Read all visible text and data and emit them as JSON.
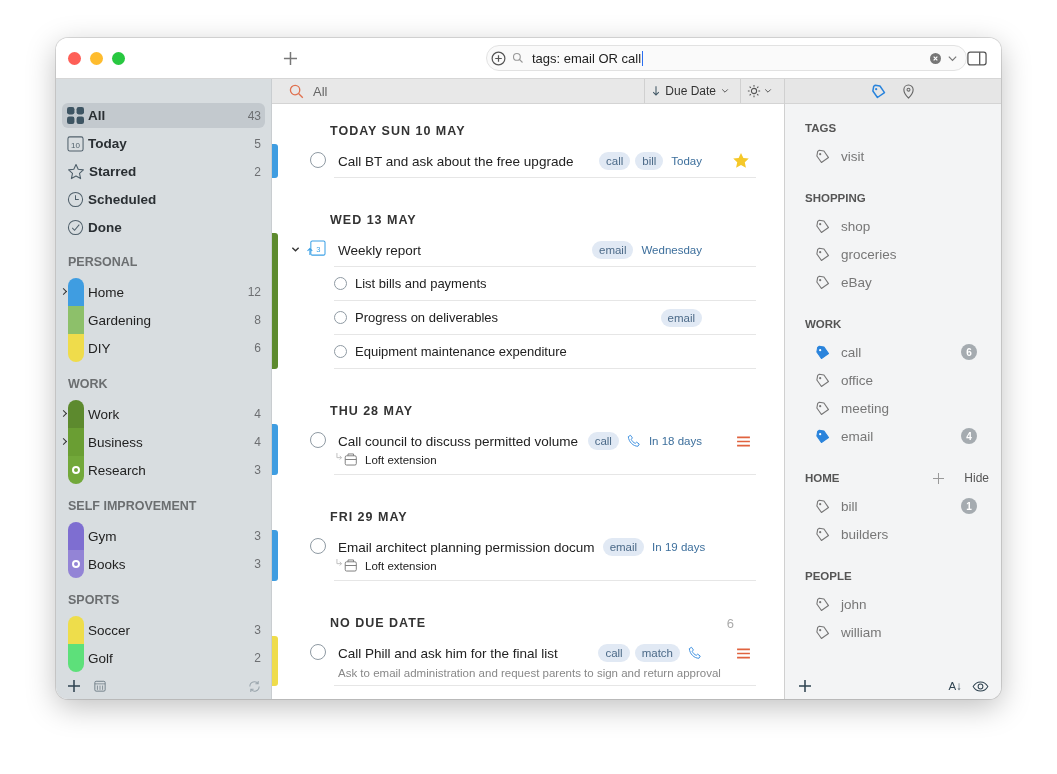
{
  "search": {
    "value": "tags: email OR call"
  },
  "filter_bar": {
    "label": "All",
    "sort": "Due Date"
  },
  "sidebar": {
    "smart": [
      {
        "kind": "all",
        "name": "All",
        "count": "43",
        "selected": true
      },
      {
        "kind": "today",
        "name": "Today",
        "count": "5",
        "day": "10",
        "selected": false
      },
      {
        "kind": "starred",
        "name": "Starred",
        "count": "2",
        "selected": false
      },
      {
        "kind": "scheduled",
        "name": "Scheduled",
        "selected": false
      },
      {
        "kind": "done",
        "name": "Done",
        "selected": false
      }
    ],
    "groups": [
      {
        "title": "PERSONAL",
        "lists": [
          {
            "name": "Home",
            "count": "12",
            "color": "#3f9de1",
            "has_children": true,
            "shared": false
          },
          {
            "name": "Gardening",
            "count": "8",
            "color": "#8dc06a",
            "has_children": false,
            "shared": false
          },
          {
            "name": "DIY",
            "count": "6",
            "color": "#efdc4b",
            "has_children": false,
            "shared": false
          }
        ]
      },
      {
        "title": "WORK",
        "lists": [
          {
            "name": "Work",
            "count": "4",
            "color": "#5d8a2e",
            "has_children": true,
            "shared": false
          },
          {
            "name": "Business",
            "count": "4",
            "color": "#6a9e33",
            "has_children": true,
            "shared": false
          },
          {
            "name": "Research",
            "count": "3",
            "color": "#72a83a",
            "has_children": false,
            "shared": true
          }
        ]
      },
      {
        "title": "SELF IMPROVEMENT",
        "lists": [
          {
            "name": "Gym",
            "count": "3",
            "color": "#7e6ed1",
            "has_children": false,
            "shared": false
          },
          {
            "name": "Books",
            "count": "3",
            "color": "#9384d6",
            "has_children": false,
            "shared": true
          }
        ]
      },
      {
        "title": "SPORTS",
        "lists": [
          {
            "name": "Soccer",
            "count": "3",
            "color": "#eedd4b",
            "has_children": false,
            "shared": false
          },
          {
            "name": "Golf",
            "count": "2",
            "color": "#5de07a",
            "has_children": false,
            "shared": false
          }
        ]
      }
    ]
  },
  "sections": [
    {
      "heading": "TODAY SUN 10 MAY",
      "tasks": [
        {
          "title": "Call BT and ask about the free upgrade",
          "checked": false,
          "color": "#3f9de1",
          "tags": [
            "call",
            "bill"
          ],
          "phone": false,
          "due": "Today",
          "starred": true,
          "priority": false
        }
      ]
    },
    {
      "heading": "WED 13 MAY",
      "tasks": [
        {
          "kind": "recurring",
          "checked": false,
          "title": "Weekly report",
          "repeat": "3",
          "expanded": true,
          "color": "#5d8a2e",
          "tags": [
            "email"
          ],
          "phone": false,
          "due": "Wednesday",
          "starred": false,
          "priority": false,
          "children": [
            {
              "title": "List bills and payments",
              "checked": false
            },
            {
              "title": "Progress on deliverables",
              "checked": false,
              "tags": [
                "email"
              ]
            },
            {
              "title": "Equipment maintenance expenditure",
              "checked": false
            }
          ]
        }
      ]
    },
    {
      "heading": "THU 28 MAY",
      "tasks": [
        {
          "title": "Call council to discuss permitted volume",
          "checked": false,
          "color": "#3f9de1",
          "tags": [
            "call"
          ],
          "phone": true,
          "due": "In 18 days",
          "starred": false,
          "priority": true,
          "project": "Loft extension"
        }
      ]
    },
    {
      "heading": "FRI 29 MAY",
      "tasks": [
        {
          "title": "Email architect planning permission docum",
          "checked": false,
          "color": "#3f9de1",
          "tags": [
            "email"
          ],
          "phone": false,
          "due": "In 19 days",
          "starred": false,
          "priority": false,
          "project": "Loft extension"
        }
      ]
    },
    {
      "heading": "NO DUE DATE",
      "count": "6",
      "tasks": [
        {
          "title": "Call Phill and ask him for the final list",
          "checked": false,
          "color": "#efdc4b",
          "tags": [
            "call",
            "match"
          ],
          "phone": true,
          "starred": false,
          "priority": true,
          "note": "Ask to email administration and request parents to sign and return approval"
        }
      ]
    }
  ],
  "tag_panel": {
    "tabs": [
      {
        "kind": "tags",
        "selected": true
      },
      {
        "kind": "places",
        "selected": false
      }
    ],
    "groups": [
      {
        "title": "TAGS",
        "tags": [
          {
            "name": "visit",
            "selected": false
          }
        ]
      },
      {
        "title": "SHOPPING",
        "tags": [
          {
            "name": "shop",
            "selected": false
          },
          {
            "name": "groceries",
            "selected": false
          },
          {
            "name": "eBay",
            "selected": false
          }
        ]
      },
      {
        "title": "WORK",
        "tags": [
          {
            "name": "call",
            "selected": true,
            "count": "6"
          },
          {
            "name": "office",
            "selected": false
          },
          {
            "name": "meeting",
            "selected": false
          },
          {
            "name": "email",
            "selected": true,
            "count": "4"
          }
        ]
      },
      {
        "title": "HOME",
        "hide": "Hide",
        "tags": [
          {
            "name": "bill",
            "selected": false,
            "count": "1"
          },
          {
            "name": "builders",
            "selected": false
          }
        ]
      },
      {
        "title": "PEOPLE",
        "tags": [
          {
            "name": "john",
            "selected": false
          },
          {
            "name": "william",
            "selected": false
          }
        ]
      }
    ],
    "sort_label": "A↓"
  }
}
